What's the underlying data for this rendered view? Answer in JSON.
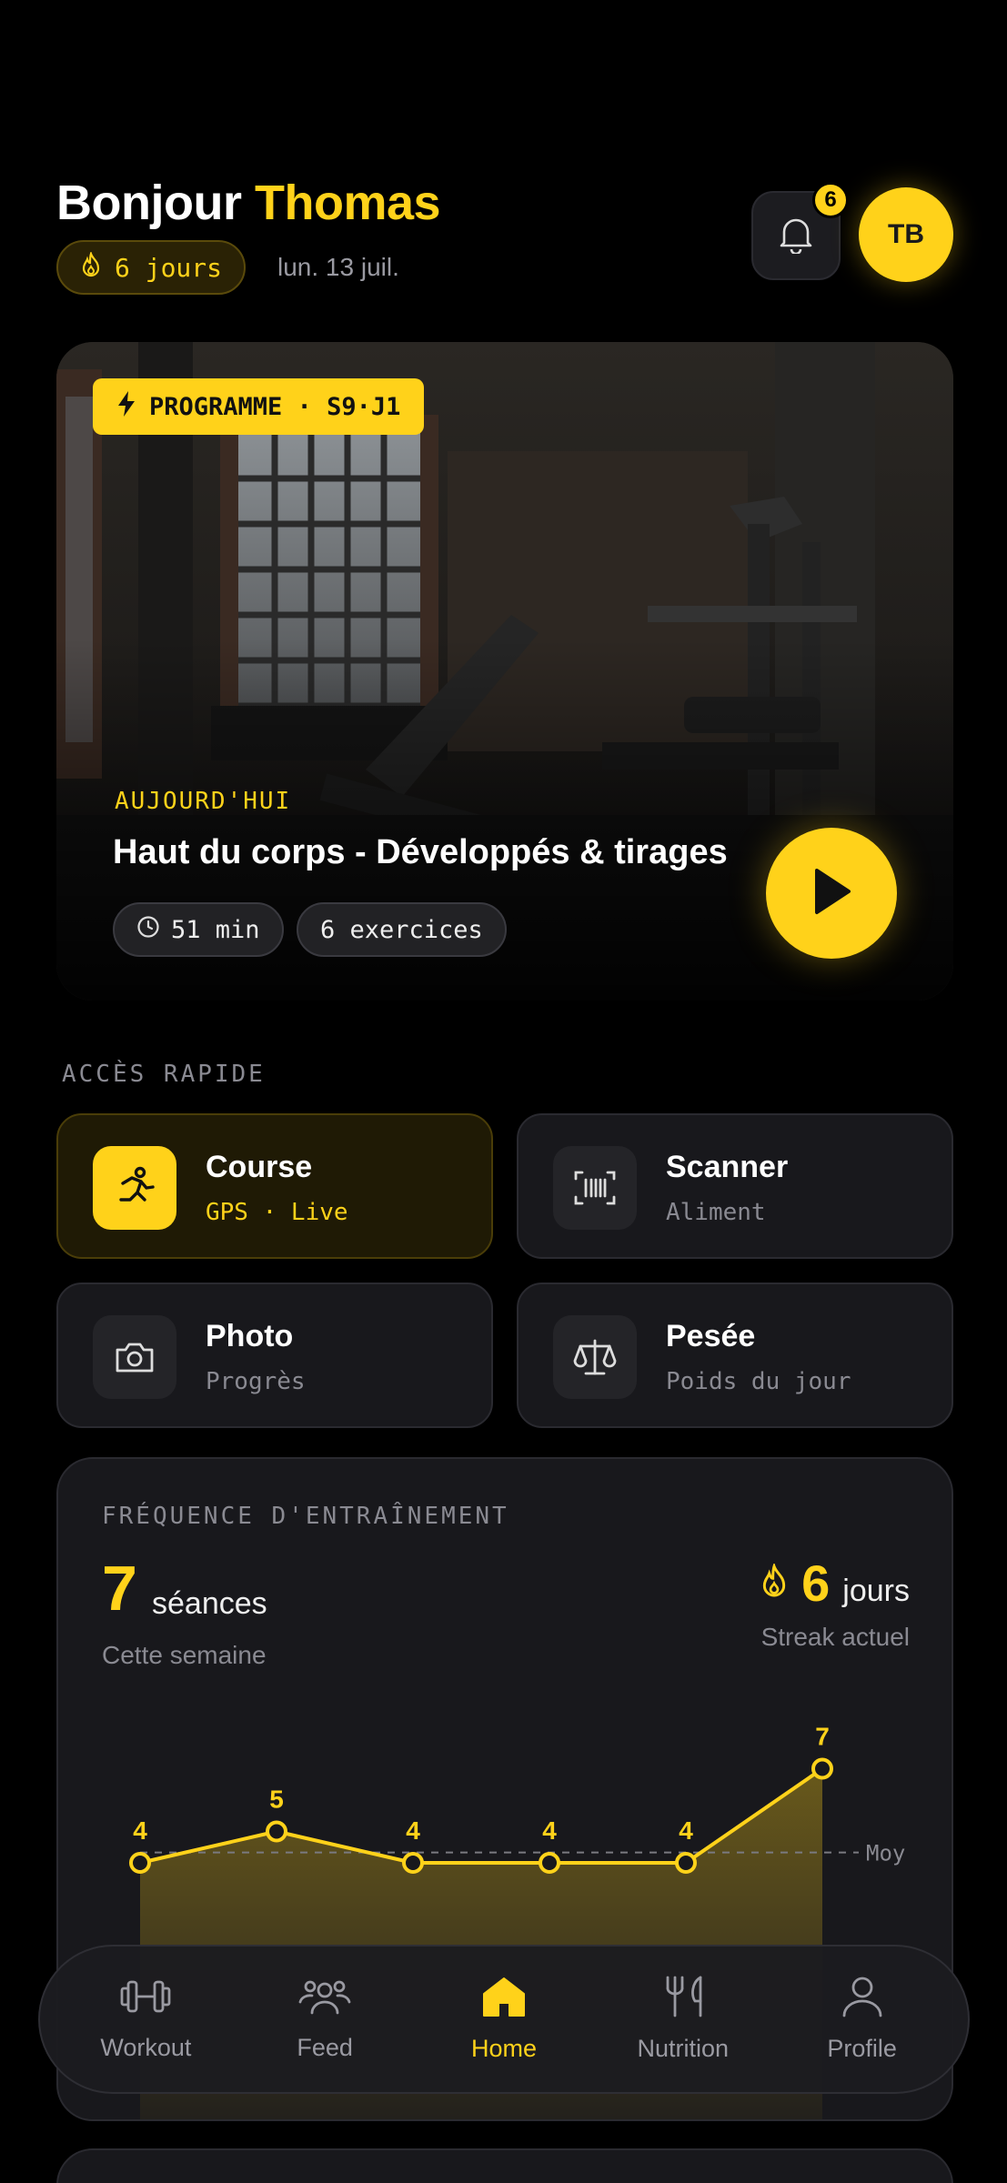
{
  "header": {
    "greeting": "Bonjour",
    "name": "Thomas",
    "streak": "6 jours",
    "date": "lun. 13 juil.",
    "notification_count": "6",
    "avatar_initials": "TB"
  },
  "hero": {
    "tag": "PROGRAMME · S9·J1",
    "eyebrow": "AUJOURD'HUI",
    "title": "Haut du corps - Développés & tirages",
    "duration": "51 min",
    "exercises": "6 exercices"
  },
  "quick_access": {
    "label": "ACCÈS RAPIDE",
    "items": [
      {
        "title": "Course",
        "subtitle": "GPS · Live",
        "icon": "running-icon"
      },
      {
        "title": "Scanner",
        "subtitle": "Aliment",
        "icon": "barcode-icon"
      },
      {
        "title": "Photo",
        "subtitle": "Progrès",
        "icon": "camera-icon"
      },
      {
        "title": "Pesée",
        "subtitle": "Poids du jour",
        "icon": "scale-icon"
      }
    ]
  },
  "frequency": {
    "label": "FRÉQUENCE D'ENTRAÎNEMENT",
    "sessions": "7",
    "sessions_unit": "séances",
    "sessions_sub": "Cette semaine",
    "streak": "6",
    "streak_unit": "jours",
    "streak_sub": "Streak actuel"
  },
  "chart_data": {
    "type": "line",
    "values": [
      4,
      5,
      4,
      4,
      4,
      7
    ],
    "reference_label": "Moy",
    "reference_value": 4.33
  },
  "tabs": [
    {
      "label": "Workout",
      "icon": "dumbbell-icon"
    },
    {
      "label": "Feed",
      "icon": "users-icon"
    },
    {
      "label": "Home",
      "icon": "home-icon",
      "active": true
    },
    {
      "label": "Nutrition",
      "icon": "fork-knife-icon"
    },
    {
      "label": "Profile",
      "icon": "user-icon"
    }
  ],
  "colors": {
    "accent": "#FFD21A",
    "background": "#000000",
    "card": "#18181C"
  }
}
